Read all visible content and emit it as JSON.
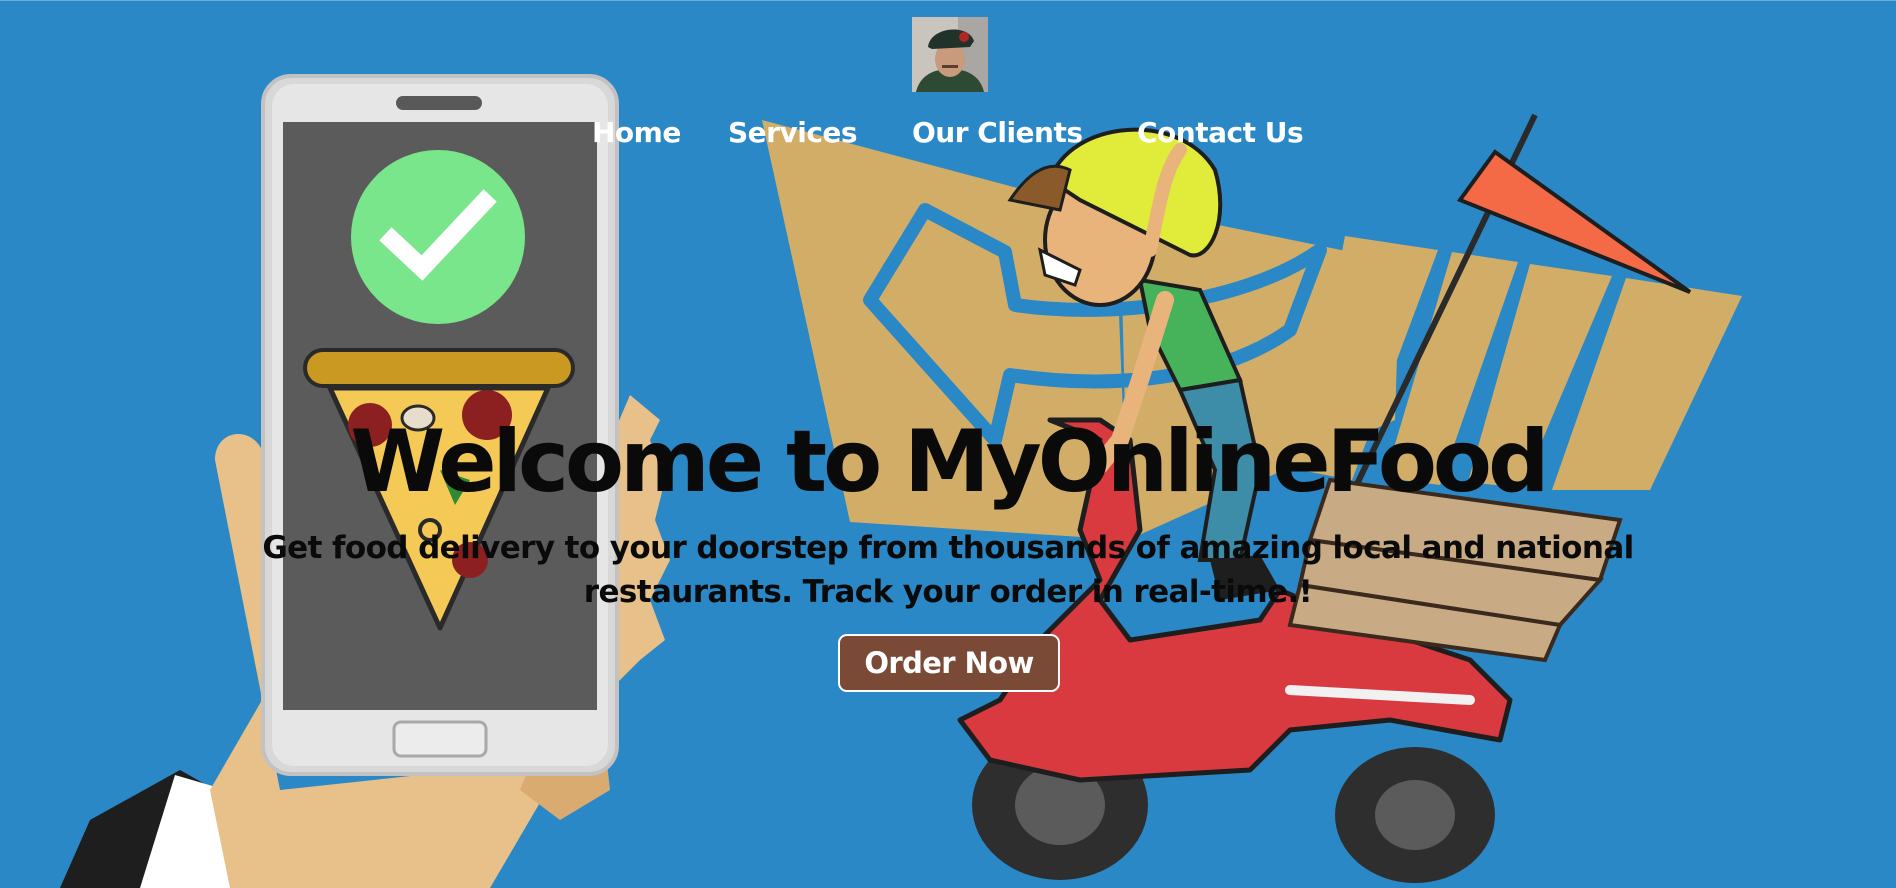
{
  "nav": {
    "items": [
      {
        "label": "Home"
      },
      {
        "label": "Services"
      },
      {
        "label": "Our Clients"
      },
      {
        "label": "Contact Us"
      }
    ]
  },
  "hero": {
    "title": "Welcome to MyOnlineFood",
    "subtitle": "Get food delivery to your doorstep from thousands of amazing local and national restaurants. Track your order in real-time.!",
    "cta_label": "Order Now"
  },
  "colors": {
    "background": "#2b88c6",
    "cta_background": "#7b4a36",
    "arrow_tan": "#d2ad67",
    "scooter_red": "#d93a3f",
    "check_green": "#79e68b"
  },
  "icons": [
    "avatar-photo",
    "smartphone-icon",
    "check-icon",
    "pizza-slice-icon",
    "delivery-boy-scooter",
    "flag-icon"
  ]
}
